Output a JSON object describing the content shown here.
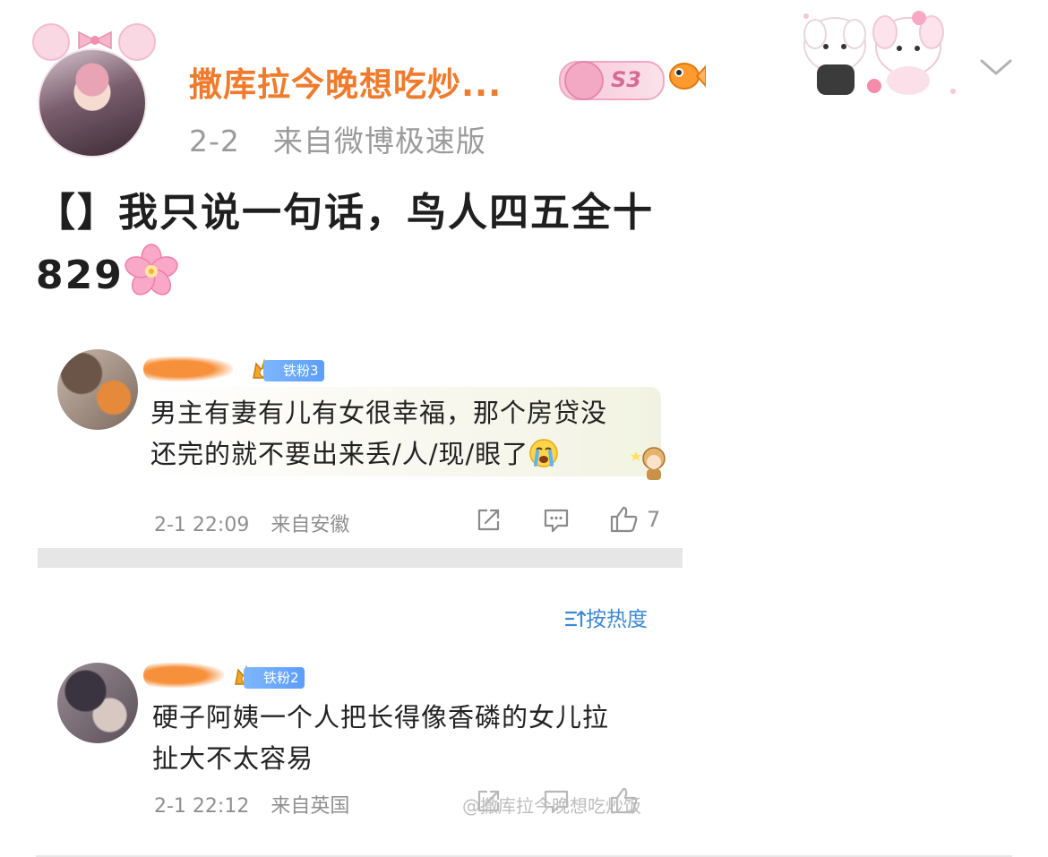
{
  "post": {
    "username": "撒库拉今晚想吃炒...",
    "level_badge": "S3",
    "date": "2-2",
    "source": "来自微博极速版",
    "body_line1": "【】我只说一句话，鸟人四五全十",
    "body_line2": "829",
    "body_emoji": "sakura-icon"
  },
  "comments": [
    {
      "fan_badge": "铁粉3",
      "text_line1": "男主有妻有儿有女很幸福，那个房贷没",
      "text_line2": "还完的就不要出来丢/人/现/眼了",
      "time": "2-1 22:09",
      "location": "来自安徽",
      "like_count": "7"
    },
    {
      "fan_badge": "铁粉2",
      "text_line1": "硬子阿姨一个人把长得像香磷的女儿拉",
      "text_line2": "扯大不太容易",
      "time": "2-1 22:12",
      "location": "来自英国",
      "like_count": ""
    }
  ],
  "sort_label": "按热度",
  "watermark": "@撒库拉今晚想吃炒饭",
  "colors": {
    "username": "#f07b2c",
    "meta": "#9b9b9b",
    "fan_badge": "#5d9dfb",
    "sort": "#3d88d4"
  }
}
